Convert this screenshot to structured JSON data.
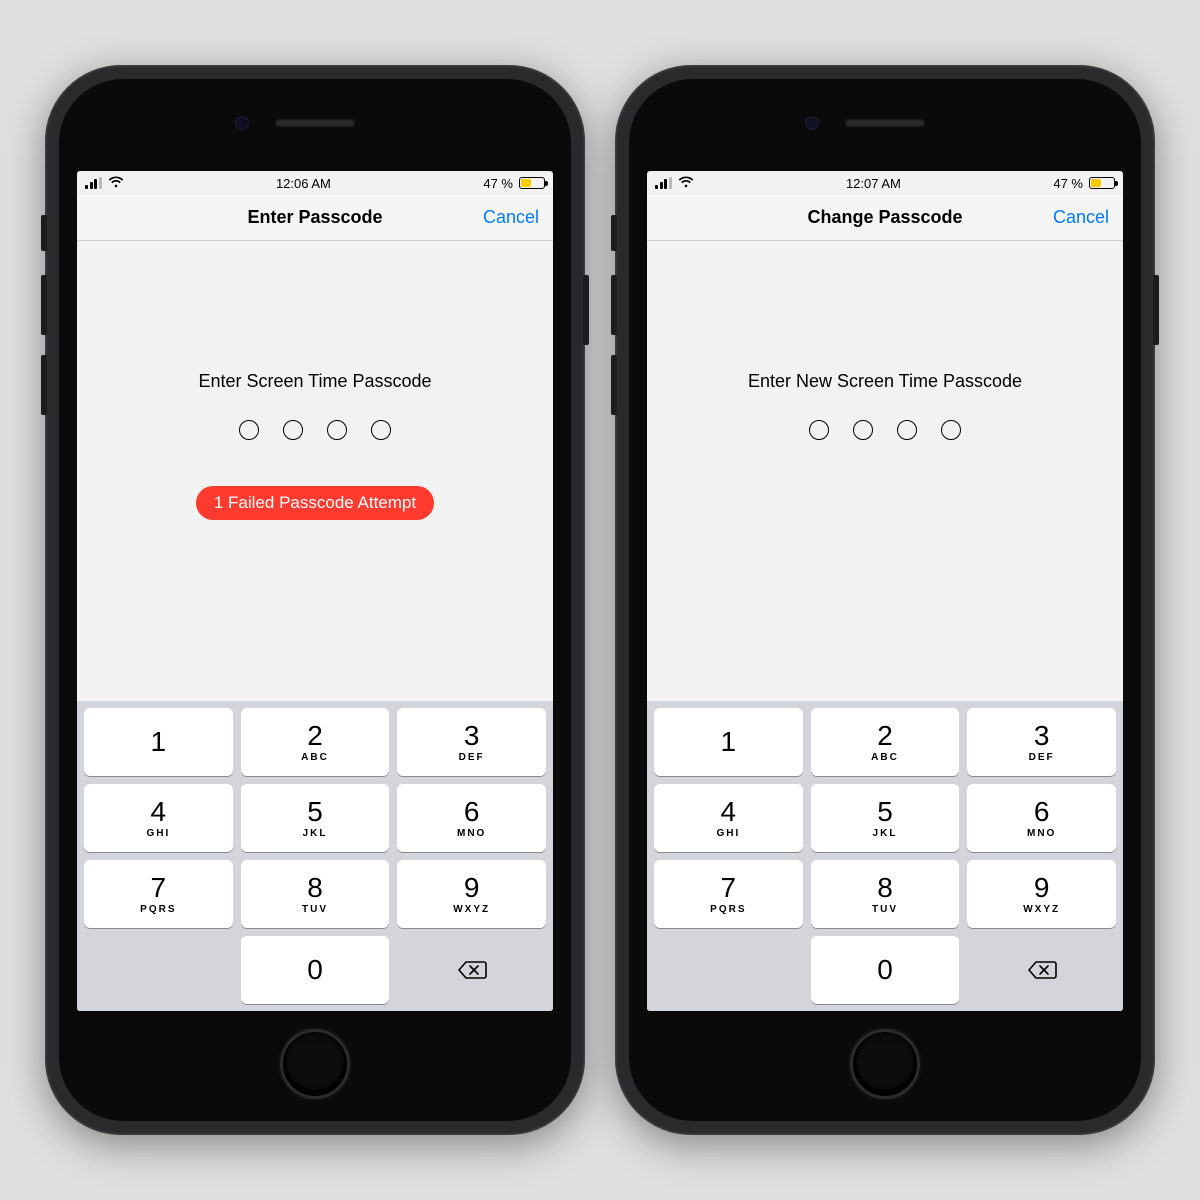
{
  "phones": [
    {
      "status": {
        "time": "12:06 AM",
        "battery_pct": "47 %"
      },
      "nav": {
        "title": "Enter Passcode",
        "cancel": "Cancel"
      },
      "prompt": "Enter Screen Time Passcode",
      "fail_msg": "1 Failed Passcode Attempt",
      "show_fail": true
    },
    {
      "status": {
        "time": "12:07 AM",
        "battery_pct": "47 %"
      },
      "nav": {
        "title": "Change Passcode",
        "cancel": "Cancel"
      },
      "prompt": "Enter New Screen Time Passcode",
      "fail_msg": "",
      "show_fail": false
    }
  ],
  "keypad": [
    {
      "num": "1",
      "sub": ""
    },
    {
      "num": "2",
      "sub": "ABC"
    },
    {
      "num": "3",
      "sub": "DEF"
    },
    {
      "num": "4",
      "sub": "GHI"
    },
    {
      "num": "5",
      "sub": "JKL"
    },
    {
      "num": "6",
      "sub": "MNO"
    },
    {
      "num": "7",
      "sub": "PQRS"
    },
    {
      "num": "8",
      "sub": "TUV"
    },
    {
      "num": "9",
      "sub": "WXYZ"
    },
    {
      "num": "",
      "sub": "",
      "blank": true
    },
    {
      "num": "0",
      "sub": ""
    },
    {
      "num": "",
      "sub": "",
      "del": true
    }
  ]
}
